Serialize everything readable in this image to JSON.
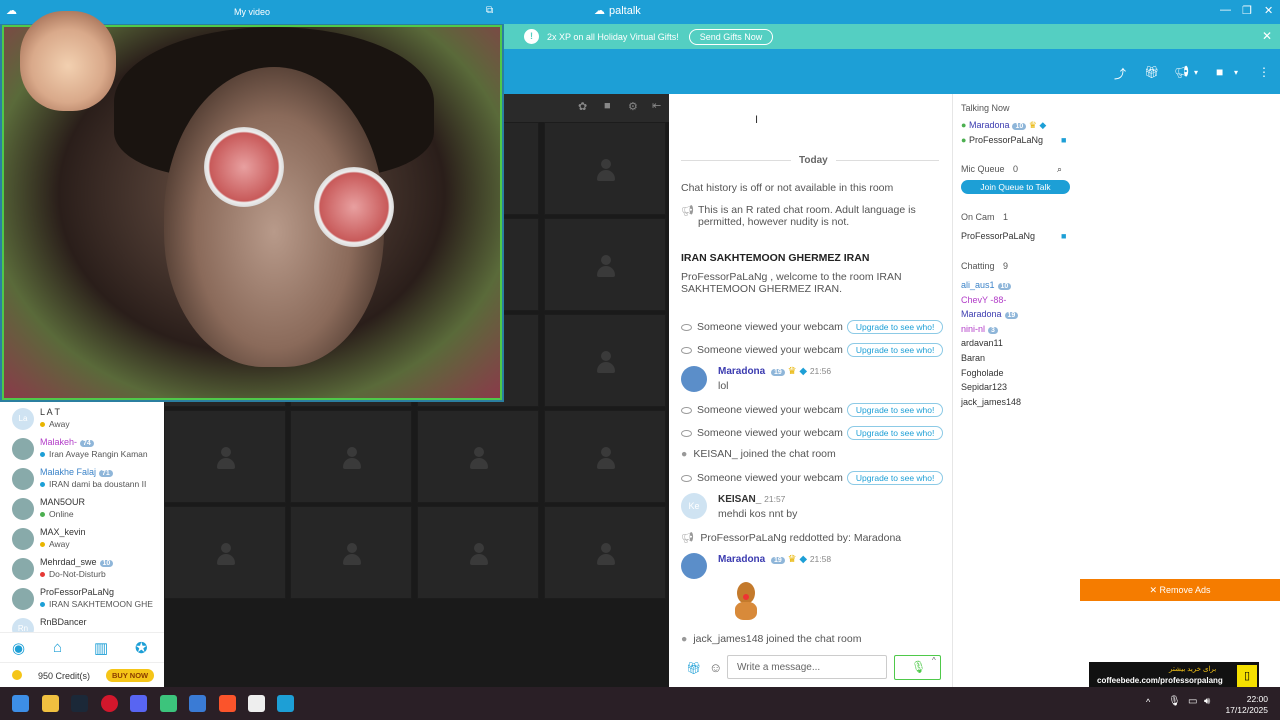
{
  "app": {
    "title": "paltalk"
  },
  "my_video": {
    "title": "My video"
  },
  "promo": {
    "text": "2x XP on all Holiday Virtual Gifts!",
    "button": "Send Gifts Now"
  },
  "sidebar": {
    "users": [
      {
        "name": "L A T",
        "status": "Away",
        "status_color": "#e8b400",
        "name_color": "#333333",
        "initials": "La"
      },
      {
        "name": "Malakeh-",
        "badge": "74",
        "status": "Iran Avaye Rangin Kaman",
        "status_color": "#1d9fd6",
        "name_color": "#b23cc8"
      },
      {
        "name": "Malakhe Falaj",
        "badge": "71",
        "status": "IRAN dami ba doustann II",
        "status_color": "#1d9fd6",
        "name_color": "#3b83c8"
      },
      {
        "name": "MAN5OUR",
        "status": "Online",
        "status_color": "#4caf50",
        "name_color": "#333333"
      },
      {
        "name": "MAX_kevin",
        "status": "Away",
        "status_color": "#e8b400",
        "name_color": "#333333"
      },
      {
        "name": "Mehrdad_swe",
        "badge": "10",
        "status": "Do-Not-Disturb",
        "status_color": "#e53935",
        "name_color": "#333333"
      },
      {
        "name": "ProFessorPaLaNg",
        "status": "IRAN SAKHTEMOON GHE",
        "status_color": "#1d9fd6",
        "name_color": "#333333"
      },
      {
        "name": "RnBDancer",
        "status": "",
        "status_color": "#4caf50",
        "name_color": "#333333",
        "initials": "Rn"
      }
    ],
    "credits": "950 Credit(s)",
    "buy_now": "BUY NOW"
  },
  "chat": {
    "date_label": "Today",
    "history_note": "Chat history is off or not available in this room",
    "rating_note": "This is an R rated chat room. Adult language is permitted, however nudity is not.",
    "room_title": "IRAN SAKHTEMOON GHERMEZ IRAN",
    "welcome": "ProFessorPaLaNg , welcome to the room  IRAN SAKHTEMOON GHERMEZ IRAN.",
    "viewed": "Someone viewed your webcam",
    "upgrade": "Upgrade to see who!",
    "m1_user": "Maradona",
    "m1_badge": "19",
    "m1_time": "21:56",
    "m1_text": "lol",
    "join1": "KEISAN_ joined the chat room",
    "m2_user": "KEISAN_",
    "m2_initials": "Ke",
    "m2_time": "21:57",
    "m2_text": "mehdi kos nnt by",
    "reddot": "ProFessorPaLaNg reddotted by: Maradona",
    "m3_user": "Maradona",
    "m3_badge": "19",
    "m3_time": "21:58",
    "join2": "jack_james148 joined the chat room",
    "compose_placeholder": "Write a message..."
  },
  "right": {
    "talking_label": "Talking Now",
    "talking": [
      {
        "name": "Maradona",
        "badge": "10"
      },
      {
        "name": "ProFessorPaLaNg"
      }
    ],
    "mic_queue_label": "Mic Queue",
    "mic_queue_count": "0",
    "join_queue": "Join Queue to Talk",
    "oncam_label": "On Cam",
    "oncam_count": "1",
    "oncam_user": "ProFessorPaLaNg",
    "chatting_label": "Chatting",
    "chatting_count": "9",
    "chatting": [
      {
        "name": "ali_aus1",
        "badge": "10",
        "color": "#3b83c8"
      },
      {
        "name": "ChevY -88-",
        "color": "#b23cc8"
      },
      {
        "name": "Maradona",
        "badge": "19",
        "color": "#3b3bb0"
      },
      {
        "name": "nini-nl",
        "badge": "3",
        "color": "#b23cc8"
      },
      {
        "name": "ardavan11",
        "color": "#333333"
      },
      {
        "name": "Baran",
        "color": "#333333"
      },
      {
        "name": "Fogholade",
        "color": "#333333"
      },
      {
        "name": "Sepidar123",
        "color": "#333333"
      },
      {
        "name": "jack_james148",
        "color": "#333333"
      }
    ]
  },
  "ads": {
    "remove": "✕ Remove Ads",
    "line1": "برای خرید بیشتر",
    "line2": "coffeebede.com/professorpalang"
  },
  "taskbar": {
    "time": "22:00",
    "date": "17/12/2025"
  },
  "colors": {
    "brand": "#1d9fd6",
    "promo": "#54cfc2",
    "cam_border": "#4fc94a",
    "ads": "#f57c00"
  }
}
